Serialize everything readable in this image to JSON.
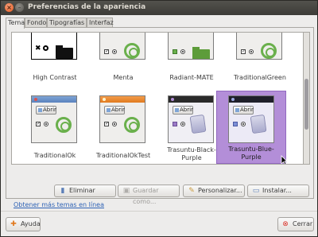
{
  "window": {
    "title": "Preferencias de la apariencia",
    "close_glyph": "×",
    "min_glyph": "–"
  },
  "tabs": [
    {
      "label": "Tema",
      "active": true
    },
    {
      "label": "Fondo",
      "active": false
    },
    {
      "label": "Tipografías",
      "active": false
    },
    {
      "label": "Interfaz",
      "active": false
    }
  ],
  "themes": [
    {
      "name": "High Contrast",
      "style": "contrast",
      "selected": false
    },
    {
      "name": "Menta",
      "style": "menta",
      "selected": false
    },
    {
      "name": "Radiant-MATE",
      "style": "radiant",
      "selected": false
    },
    {
      "name": "TraditionalGreen",
      "style": "green",
      "selected": false
    },
    {
      "name": "TraditionalOk",
      "style": "ok",
      "abrir": "Abrir",
      "selected": false
    },
    {
      "name": "TraditionalOkTest",
      "style": "oktest",
      "abrir": "Abrir",
      "selected": false
    },
    {
      "name": "Trasuntu-Black-\nPurple",
      "style": "black",
      "abrir": "Abrir",
      "selected": false
    },
    {
      "name": "Trasuntu-Blue-\nPurple",
      "style": "blue",
      "abrir": "Abrir",
      "selected": true
    }
  ],
  "actions": {
    "delete": "Eliminar",
    "save_as": "Guardar como...",
    "customize": "Personalizar...",
    "install": "Instalar..."
  },
  "more_themes_link": "Obtener más temas en línea",
  "footer": {
    "help": "Ayuda",
    "close": "Cerrar"
  },
  "colors": {
    "selection": "#b38ed8",
    "link": "#2f63b6",
    "titlebar": "#3c3b37"
  }
}
